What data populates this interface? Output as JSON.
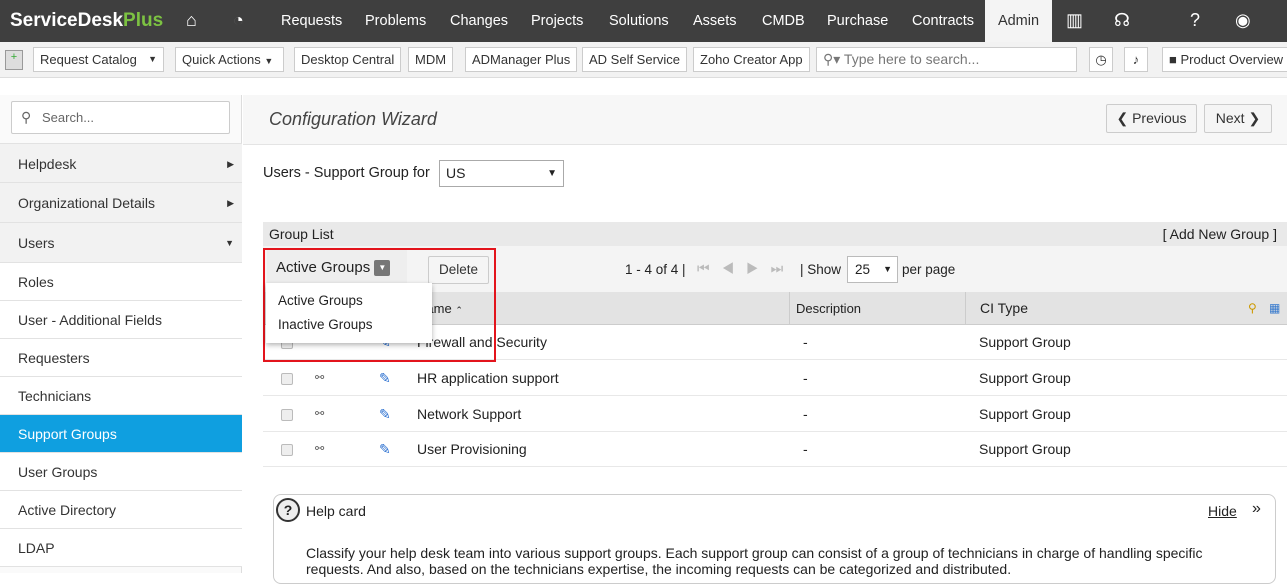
{
  "app": {
    "brand_main": "ServiceDesk",
    "brand_accent": "Plus"
  },
  "nav": [
    "Requests",
    "Problems",
    "Changes",
    "Projects",
    "Solutions",
    "Assets",
    "CMDB",
    "Purchase",
    "Contracts",
    "Admin"
  ],
  "toolbar": {
    "items": [
      "Request Catalog",
      "Quick Actions",
      "Desktop Central",
      "MDM",
      "ADManager Plus",
      "AD Self Service",
      "Zoho Creator App"
    ],
    "search_placeholder": "Type here to search...",
    "product_overview": "Product Overview"
  },
  "sidebar": {
    "search_placeholder": "Search...",
    "items": [
      {
        "label": "Helpdesk"
      },
      {
        "label": "Organizational Details"
      },
      {
        "label": "Users"
      }
    ],
    "subitems": [
      "Roles",
      "User - Additional Fields",
      "Requesters",
      "Technicians",
      "Support Groups",
      "User Groups",
      "Active Directory",
      "LDAP"
    ],
    "selected": "Support Groups"
  },
  "page": {
    "title": "Configuration Wizard",
    "previous": "Previous",
    "next": "Next",
    "site_label": "Users - Support Group for",
    "site_value": "US"
  },
  "group_list": {
    "title": "Group List",
    "add_new": "[ Add New Group ]",
    "filter": "Active Groups",
    "delete": "Delete",
    "pagination": "1 - 4 of 4 |",
    "show": "| Show",
    "per_page_value": "25",
    "per_page": "per page",
    "filter_options": [
      "Active Groups",
      "Inactive Groups"
    ],
    "columns": [
      "Name",
      "Description",
      "CI Type"
    ],
    "rows": [
      [
        "Firewall and Security",
        "-",
        "Support Group"
      ],
      [
        "HR application support",
        "-",
        "Support Group"
      ],
      [
        "Network Support",
        "-",
        "Support Group"
      ],
      [
        "User Provisioning",
        "-",
        "Support Group"
      ]
    ]
  },
  "help": {
    "title": "Help card",
    "hide": "Hide",
    "text": "Classify your help desk team into various support groups. Each support group can consist of a group of technicians in charge of handling specific requests. And also, based on the technicians expertise, the incoming requests can be categorized and distributed."
  },
  "colors": {
    "accent": "#0f9fe0",
    "brand_green": "#7cc242",
    "highlight": "#e3141c"
  }
}
